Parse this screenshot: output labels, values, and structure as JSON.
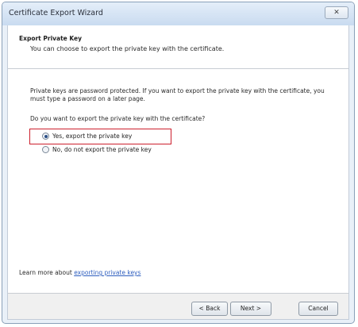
{
  "window": {
    "title": "Certificate Export Wizard",
    "close_glyph": "✕"
  },
  "header": {
    "title": "Export Private Key",
    "subtitle": "You can choose to export the private key with the certificate."
  },
  "body": {
    "paragraph": "Private keys are password protected. If you want to export the private key with the certificate, you must type a password on a later page.",
    "question": "Do you want to export the private key with the certificate?"
  },
  "options": {
    "yes_label": "Yes, export the private key",
    "no_label": "No, do not export the private key",
    "selected": "yes"
  },
  "footer": {
    "learn_prefix": "Learn more about ",
    "learn_link": "exporting private keys",
    "back_label": "< Back",
    "next_label": "Next >",
    "cancel_label": "Cancel"
  },
  "colors": {
    "highlight_border": "#cc1f2d",
    "link": "#2f5fbf"
  }
}
